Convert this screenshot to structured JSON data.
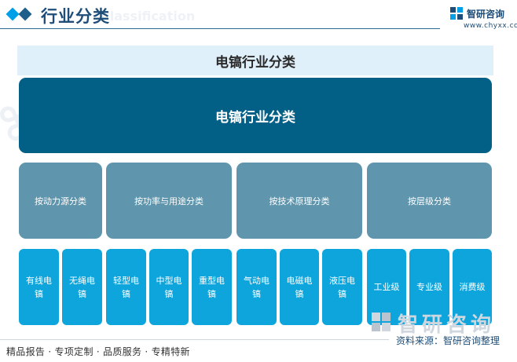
{
  "header": {
    "section_title": "行业分类",
    "section_title_en": "Classification",
    "logo_name": "智研咨询",
    "logo_url": "www.chyxx.com"
  },
  "diagram": {
    "band_title": "电镐行业分类",
    "root": "电镐行业分类",
    "categories": [
      {
        "label": "按动力源分类",
        "children": [
          "有线电镐",
          "无绳电镐"
        ]
      },
      {
        "label": "按功率与用途分类",
        "children": [
          "轻型电镐",
          "中型电镐",
          "重型电镐"
        ]
      },
      {
        "label": "按技术原理分类",
        "children": [
          "气动电镐",
          "电磁电镐",
          "液压电镐"
        ]
      },
      {
        "label": "按层级分类",
        "children": [
          "工业级",
          "专业级",
          "消费级"
        ]
      }
    ]
  },
  "source": {
    "watermark": "智研咨询",
    "text": "资料来源：智研咨询整理"
  },
  "footer": {
    "text": "精品报告 · 专项定制 · 品质服务 · 专精特新"
  },
  "colors": {
    "root": "#025f86",
    "category": "#5f96ad",
    "leaf": "#0ea5dc",
    "band": "#e0f0fa"
  }
}
